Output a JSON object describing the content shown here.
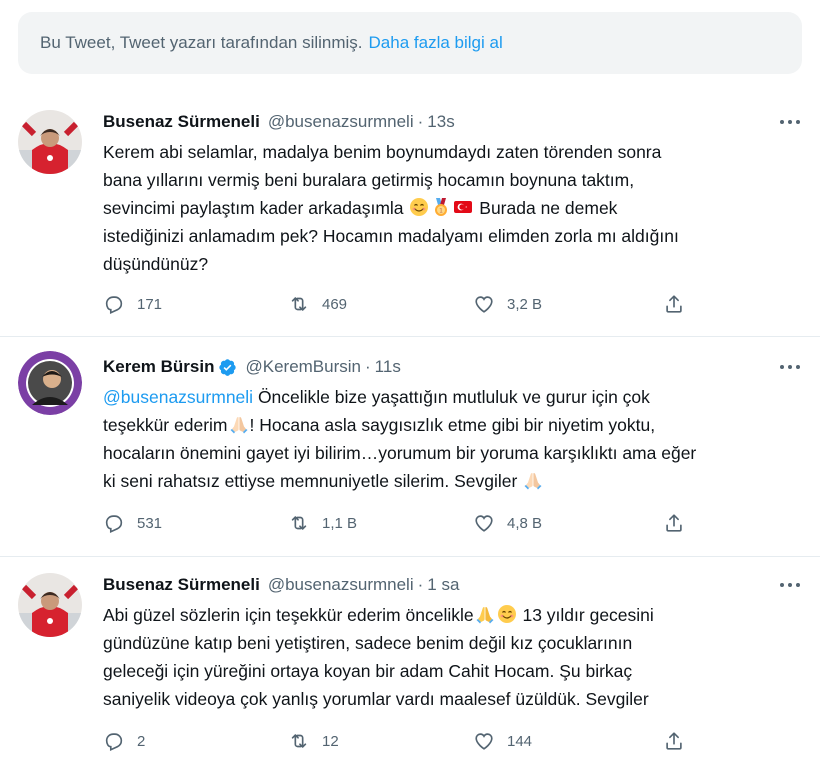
{
  "deleted_notice": {
    "text": "Bu Tweet, Tweet yazarı tarafından silinmiş.",
    "link": "Daha fazla bilgi al"
  },
  "tweets": [
    {
      "name": "Busenaz Sürmeneli",
      "handle": "@busenazsurmneli",
      "time": "13s",
      "lines": [
        "Kerem abi selamlar, madalya benim boynumdaydı zaten törenden sonra",
        "bana yıllarını vermiş beni buralara getirmiş hocamın boynuna taktım,",
        "sevincimi paylaştım kader arkadaşımla",
        "Burada ne demek",
        "istediğinizi anlamadım pek? Hocamın madalyamı elimden zorla mı aldığını",
        "düşündünüz?"
      ],
      "emojis": [
        "smiling-face",
        "medal",
        "turkish-flag"
      ],
      "replies": "171",
      "retweets": "469",
      "likes": "3,2 B"
    },
    {
      "name": "Kerem Bürsin",
      "handle": "@KeremBursin",
      "time": "11s",
      "mention": "@busenazsurmneli",
      "lines": [
        "Öncelikle bize yaşattığın mutluluk ve gurur için çok",
        "teşekkür ederim",
        "! Hocana asla saygısızlık etme gibi bir niyetim yoktu,",
        "hocaların önemini gayet iyi bilirim…yorumum bir yoruma karşıklıktı ama eğer",
        "ki seni rahatsız ettiyse memnuniyetle silerim. Sevgiler"
      ],
      "emojis": [
        "praying-hands"
      ],
      "replies": "531",
      "retweets": "1,1 B",
      "likes": "4,8 B"
    },
    {
      "name": "Busenaz Sürmeneli",
      "handle": "@busenazsurmneli",
      "time": "1 sa",
      "lines": [
        "Abi güzel sözlerin için teşekkür ederim öncelikle",
        "13 yıldır gecesini",
        "gündüzüne katıp beni yetiştiren, sadece benim değil kız çocuklarının",
        "geleceği için yüreğini ortaya koyan bir adam Cahit Hocam. Şu birkaç",
        "saniyelik videoya çok yanlış yorumlar vardı maalesef üzüldük. Sevgiler"
      ],
      "emojis": [
        "praying-hands",
        "smiling-face"
      ],
      "replies": "2",
      "retweets": "12",
      "likes": "144"
    }
  ],
  "colors": {
    "accent": "#1d9bf0",
    "secondary_text": "#536471",
    "banner_bg": "#f2f4f5"
  }
}
